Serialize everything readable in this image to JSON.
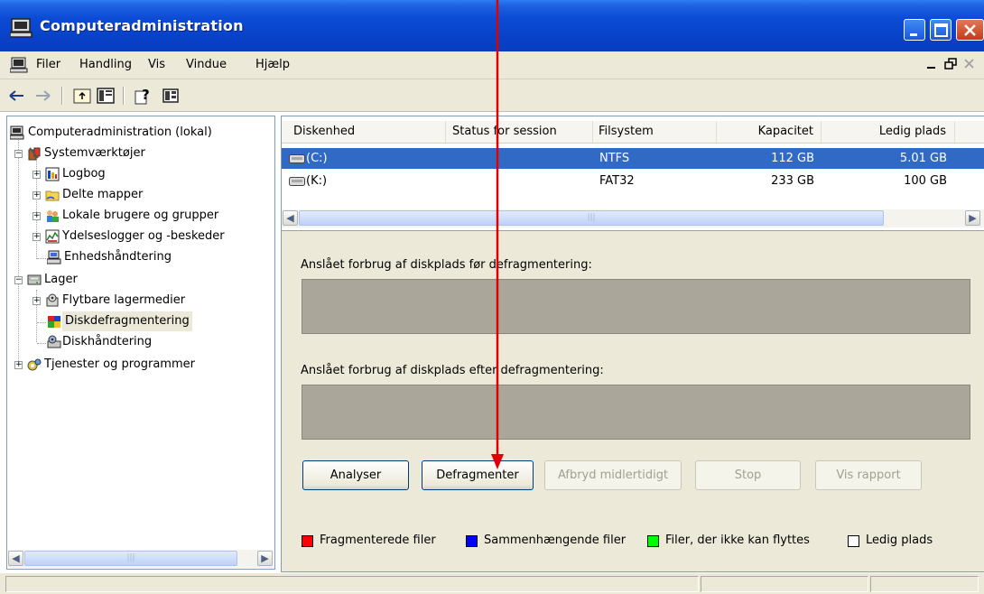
{
  "window": {
    "title": "Computeradministration",
    "icon": "computer-management-icon"
  },
  "menubar": {
    "items": [
      "Filer",
      "Handling",
      "Vis",
      "Vindue",
      "Hjælp"
    ]
  },
  "toolbar": {
    "icons": [
      "back-arrow-icon",
      "forward-arrow-icon",
      "up-folder-icon",
      "show-hide-tree-icon",
      "help-icon",
      "properties-icon"
    ]
  },
  "tree": {
    "root": "Computeradministration (lokal)",
    "system_tools": "Systemværktøjer",
    "event_viewer": "Logbog",
    "shared_folders": "Delte mapper",
    "local_users": "Lokale brugere og grupper",
    "perf_logs": "Ydelseslogger og -beskeder",
    "device_manager": "Enhedshåndtering",
    "storage": "Lager",
    "removable": "Flytbare lagermedier",
    "defrag": "Diskdefragmentering",
    "disk_mgmt": "Diskhåndtering",
    "services": "Tjenester og programmer"
  },
  "volumes": {
    "columns": [
      "Diskenhed",
      "Status for session",
      "Filsystem",
      "Kapacitet",
      "Ledig plads"
    ],
    "rows": [
      {
        "volume": "(C:)",
        "status": "",
        "filesystem": "NTFS",
        "capacity": "112 GB",
        "free": "5.01 GB",
        "selected": true
      },
      {
        "volume": "(K:)",
        "status": "",
        "filesystem": "FAT32",
        "capacity": "233 GB",
        "free": "100 GB",
        "selected": false
      }
    ]
  },
  "defrag": {
    "before_label": "Anslået forbrug af diskplads før defragmentering:",
    "after_label": "Anslået forbrug af diskplads efter defragmentering:",
    "buttons": {
      "analyze": "Analyser",
      "defragment": "Defragmenter",
      "pause": "Afbryd midlertidigt",
      "stop": "Stop",
      "report": "Vis rapport"
    },
    "legend": [
      {
        "label": "Fragmenterede filer",
        "color": "#ff0000"
      },
      {
        "label": "Sammenhængende filer",
        "color": "#0000ff"
      },
      {
        "label": "Filer, der ikke kan flyttes",
        "color": "#00ff00"
      },
      {
        "label": "Ledig plads",
        "color": "#ffffff"
      }
    ]
  },
  "colors": {
    "selection": "#316ac5",
    "annotation_arrow": "#e00000",
    "title_bar": "#0a46cc"
  }
}
